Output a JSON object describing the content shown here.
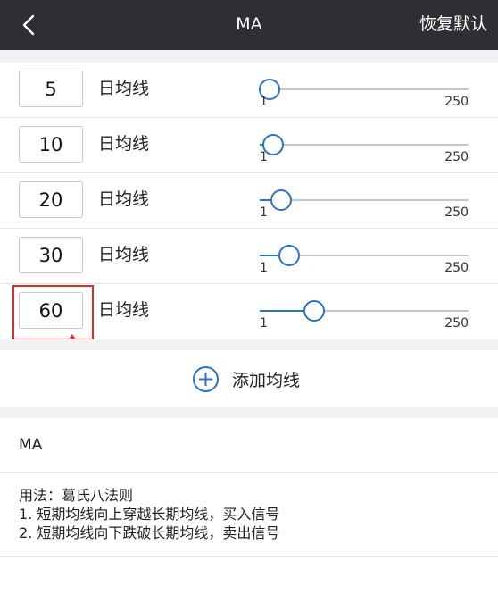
{
  "header": {
    "title": "MA",
    "reset_label": "恢复默认",
    "back_icon": "chevron-left-icon"
  },
  "slider": {
    "min": 1,
    "max": 250,
    "min_label": "1",
    "max_label": "250"
  },
  "ma_rows": [
    {
      "period": "5",
      "value": 5,
      "label": "日均线"
    },
    {
      "period": "10",
      "value": 10,
      "label": "日均线"
    },
    {
      "period": "20",
      "value": 20,
      "label": "日均线"
    },
    {
      "period": "30",
      "value": 30,
      "label": "日均线"
    },
    {
      "period": "60",
      "value": 60,
      "label": "日均线"
    }
  ],
  "add_button": {
    "label": "添加均线",
    "icon": "plus-circle-icon"
  },
  "info": {
    "title": "MA",
    "lines": [
      "用法：葛氏八法则",
      "1. 短期均线向上穿越长期均线，买入信号",
      "2. 短期均线向下跌破长期均线，卖出信号"
    ]
  },
  "colors": {
    "accent": "#2a73c9",
    "header_bg": "#2e2f33",
    "highlight": "#e02b2b"
  }
}
